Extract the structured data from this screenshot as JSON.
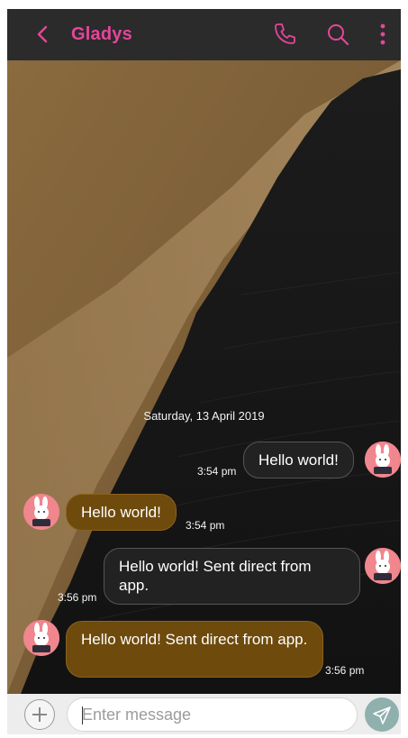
{
  "header": {
    "contact_name": "Gladys",
    "back_icon": "chevron-left-icon",
    "call_icon": "phone-icon",
    "search_icon": "search-icon",
    "menu_icon": "more-vertical-icon",
    "accent_color": "#e6459b"
  },
  "conversation": {
    "date_separator": "Saturday, 13 April 2019",
    "messages": [
      {
        "direction": "outgoing",
        "text": "Hello world!",
        "time": "3:54 pm"
      },
      {
        "direction": "incoming",
        "text": "Hello world!",
        "time": "3:54 pm"
      },
      {
        "direction": "outgoing",
        "text": "Hello world! Sent direct from app.",
        "time": "3:56 pm"
      },
      {
        "direction": "incoming",
        "text": "Hello world! Sent direct from app.",
        "time": "3:56 pm"
      }
    ],
    "avatar_icon": "bunny-avatar-icon"
  },
  "composer": {
    "add_icon": "plus-icon",
    "placeholder": "Enter message",
    "value": "",
    "send_icon": "send-icon"
  },
  "colors": {
    "header_bg": "#2b2b2b",
    "outgoing_bubble": "#222222",
    "incoming_bubble": "#6e4a0c",
    "send_button": "#8fb0ad"
  }
}
